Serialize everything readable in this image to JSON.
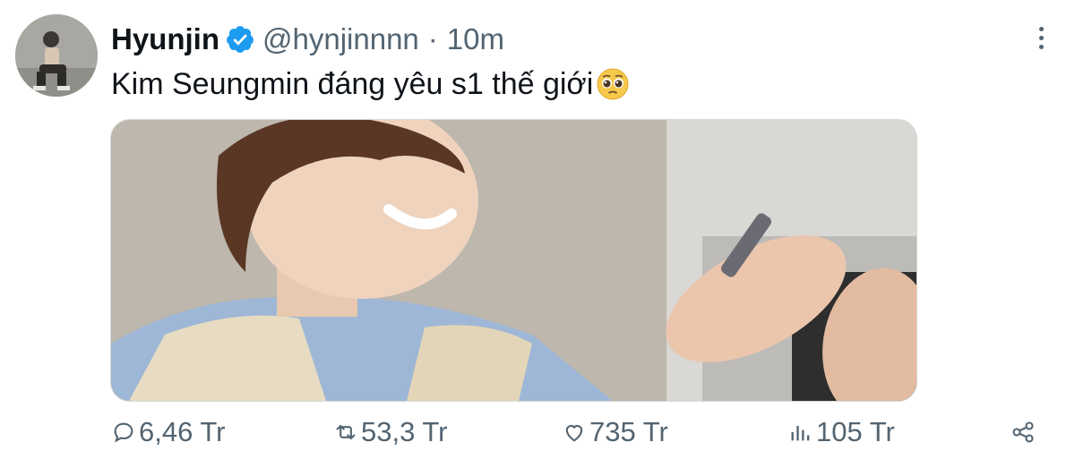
{
  "tweet": {
    "author_name": "Hyunjin",
    "handle": "@hynjinnnn",
    "separator": "·",
    "time": "10m",
    "text": "Kim Seungmin đáng yêu s1 thế giới",
    "emoji": "pleading-face-emoji"
  },
  "actions": {
    "replies": "6,46 Tr",
    "retweets": "53,3 Tr",
    "likes": "735 Tr",
    "views": "105 Tr"
  },
  "icons": {
    "verified": "verified-badge-icon",
    "more": "more-vertical-icon",
    "reply": "reply-icon",
    "retweet": "retweet-icon",
    "like": "heart-icon",
    "views": "analytics-icon",
    "share": "share-icon"
  },
  "colors": {
    "verified": "#1d9bf0",
    "text": "#0f1419",
    "secondary": "#536471"
  }
}
